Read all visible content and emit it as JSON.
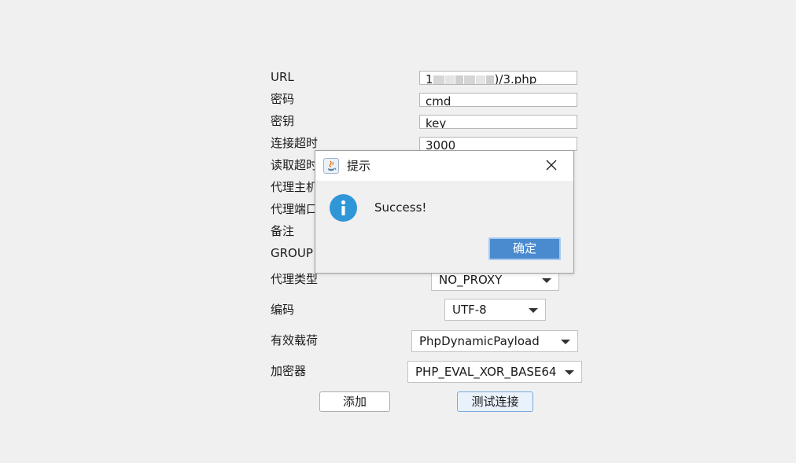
{
  "form": {
    "url_label": "URL",
    "url_value_start": "1",
    "url_value_end": ")/3.php",
    "password_label": "密码",
    "password_value": "cmd",
    "key_label": "密钥",
    "key_value": "key",
    "connect_timeout_label": "连接超时",
    "connect_timeout_value": "3000",
    "read_timeout_label": "读取超时",
    "proxy_host_label": "代理主机",
    "proxy_port_label": "代理端口",
    "remark_label": "备注",
    "group_label": "GROUP",
    "proxy_type_label": "代理类型",
    "proxy_type_value": "NO_PROXY",
    "encoding_label": "编码",
    "encoding_value": "UTF-8",
    "payload_label": "有效载荷",
    "payload_value": "PhpDynamicPayload",
    "cryption_label": "加密器",
    "cryption_value": "PHP_EVAL_XOR_BASE64",
    "add_button": "添加",
    "test_button": "测试连接"
  },
  "dialog": {
    "title": "提示",
    "message": "Success!",
    "ok_button": "确定"
  },
  "colors": {
    "info_icon": "#2f97d8",
    "ok_button_bg": "#4a8bd0",
    "background": "#f0f0f0"
  }
}
